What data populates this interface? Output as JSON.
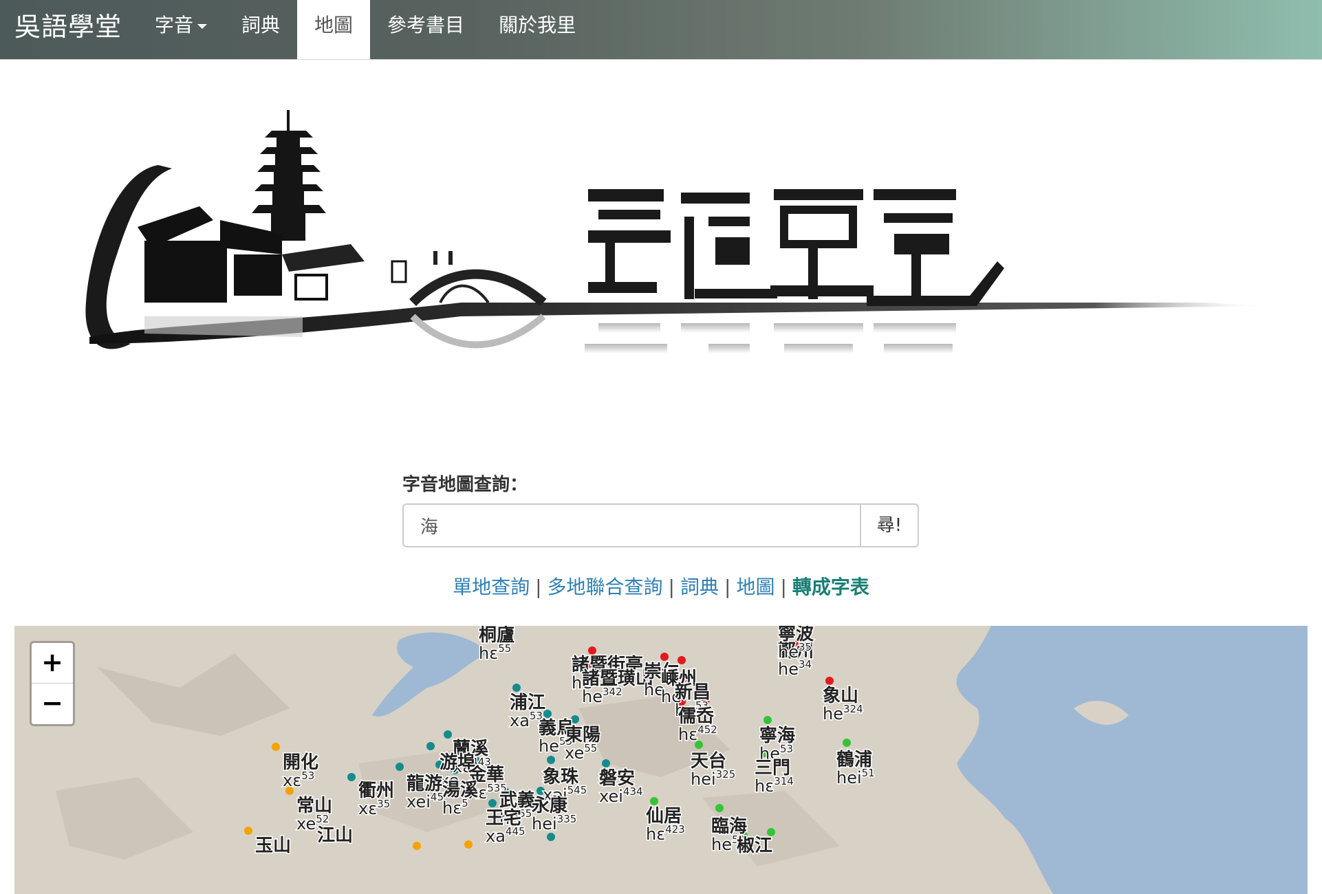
{
  "navbar": {
    "brand": "吳語學堂",
    "items": [
      {
        "label": "字音",
        "dropdown": true
      },
      {
        "label": "詞典"
      },
      {
        "label": "地圖",
        "active": true
      },
      {
        "label": "參考書目"
      },
      {
        "label": "關於我里"
      }
    ]
  },
  "search": {
    "label": "字音地圖查詢：",
    "value": "海",
    "button": "尋!"
  },
  "links": [
    {
      "label": "單地查詢"
    },
    {
      "label": "多地聯合查詢"
    },
    {
      "label": "詞典"
    },
    {
      "label": "地圖"
    },
    {
      "label": "轉成字表",
      "emphasis": true
    }
  ],
  "map": {
    "zoom_in": "+",
    "zoom_out": "−",
    "colors": {
      "red": "#e31a1c",
      "teal": "#168b8b",
      "green": "#35c435",
      "orange": "#f5a300",
      "sea": "#9fb9d4",
      "land": "#d8d1c6"
    },
    "labels": [
      {
        "name": "桐廬",
        "ipa": "hɛ",
        "tone": "55"
      },
      {
        "name": "諸暨街亭",
        "ipa": "he",
        "tone": ""
      },
      {
        "name": "諸暨璜山",
        "ipa": "he",
        "tone": "342"
      },
      {
        "name": "崇仁",
        "ipa": "he",
        "tone": ""
      },
      {
        "name": "嵊州",
        "ipa": "he",
        "tone": ""
      },
      {
        "name": "新昌",
        "ipa": "he",
        "tone": "53"
      },
      {
        "name": "儒岙",
        "ipa": "hɛ",
        "tone": "452"
      },
      {
        "name": "鄞州",
        "ipa": "he",
        "tone": "34"
      },
      {
        "name": "寧波",
        "ipa": "he",
        "tone": "35"
      },
      {
        "name": "象山",
        "ipa": "he",
        "tone": "324"
      },
      {
        "name": "浦江",
        "ipa": "xa",
        "tone": "53"
      },
      {
        "name": "義烏",
        "ipa": "he",
        "tone": "53"
      },
      {
        "name": "東陽",
        "ipa": "xe",
        "tone": "55"
      },
      {
        "name": "蘭溪",
        "ipa": "xɛ",
        "tone": "443"
      },
      {
        "name": "游埠",
        "ipa": "xe",
        "tone": ""
      },
      {
        "name": "金華",
        "ipa": "xɛ",
        "tone": "535"
      },
      {
        "name": "湯溪",
        "ipa": "hɛ",
        "tone": "5"
      },
      {
        "name": "龍游",
        "ipa": "xei",
        "tone": "45"
      },
      {
        "name": "衢州",
        "ipa": "xɛ",
        "tone": "35"
      },
      {
        "name": "開化",
        "ipa": "xɛ",
        "tone": "53"
      },
      {
        "name": "常山",
        "ipa": "xe",
        "tone": "52"
      },
      {
        "name": "江山",
        "ipa": "",
        "tone": ""
      },
      {
        "name": "玉山",
        "ipa": "",
        "tone": ""
      },
      {
        "name": "象珠",
        "ipa": "xəi",
        "tone": "545"
      },
      {
        "name": "磐安",
        "ipa": "xei",
        "tone": "434"
      },
      {
        "name": "武義",
        "ipa": "hɛ",
        "tone": "55"
      },
      {
        "name": "永康",
        "ipa": "hei",
        "tone": "335"
      },
      {
        "name": "王宅",
        "ipa": "xa",
        "tone": "445"
      },
      {
        "name": "天台",
        "ipa": "hei",
        "tone": "325"
      },
      {
        "name": "寧海",
        "ipa": "he",
        "tone": "53"
      },
      {
        "name": "三門",
        "ipa": "hɛ",
        "tone": "314"
      },
      {
        "name": "鶴浦",
        "ipa": "hei",
        "tone": "51"
      },
      {
        "name": "仙居",
        "ipa": "hɛ",
        "tone": "423"
      },
      {
        "name": "臨海",
        "ipa": "he",
        "tone": "53"
      },
      {
        "name": "椒江",
        "ipa": "",
        "tone": ""
      }
    ]
  }
}
